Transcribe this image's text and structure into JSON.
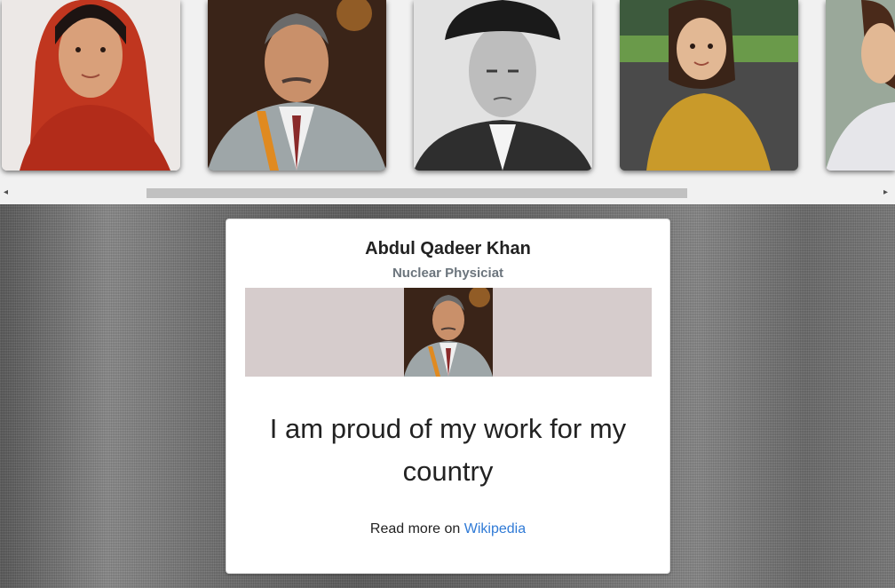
{
  "gallery": {
    "photos": [
      {
        "name": "woman-red-scarf",
        "color": "#c83020"
      },
      {
        "name": "man-grey-suit",
        "color": "#9aa3a6"
      },
      {
        "name": "man-karakul-cap",
        "color": "#d8d8d8"
      },
      {
        "name": "girl-yellow-dress",
        "color": "#c89a30"
      },
      {
        "name": "woman-partial",
        "color": "#e6e0dc"
      }
    ]
  },
  "scrollbar": {
    "left_arrow": "◂",
    "right_arrow": "▸"
  },
  "card": {
    "name": "Abdul Qadeer Khan",
    "role": "Nuclear Physiciat",
    "quote": "I am proud of my work for my country",
    "read_more_prefix": "Read more on ",
    "read_more_link": "Wikipedia",
    "link_color": "#2f7ad6"
  }
}
